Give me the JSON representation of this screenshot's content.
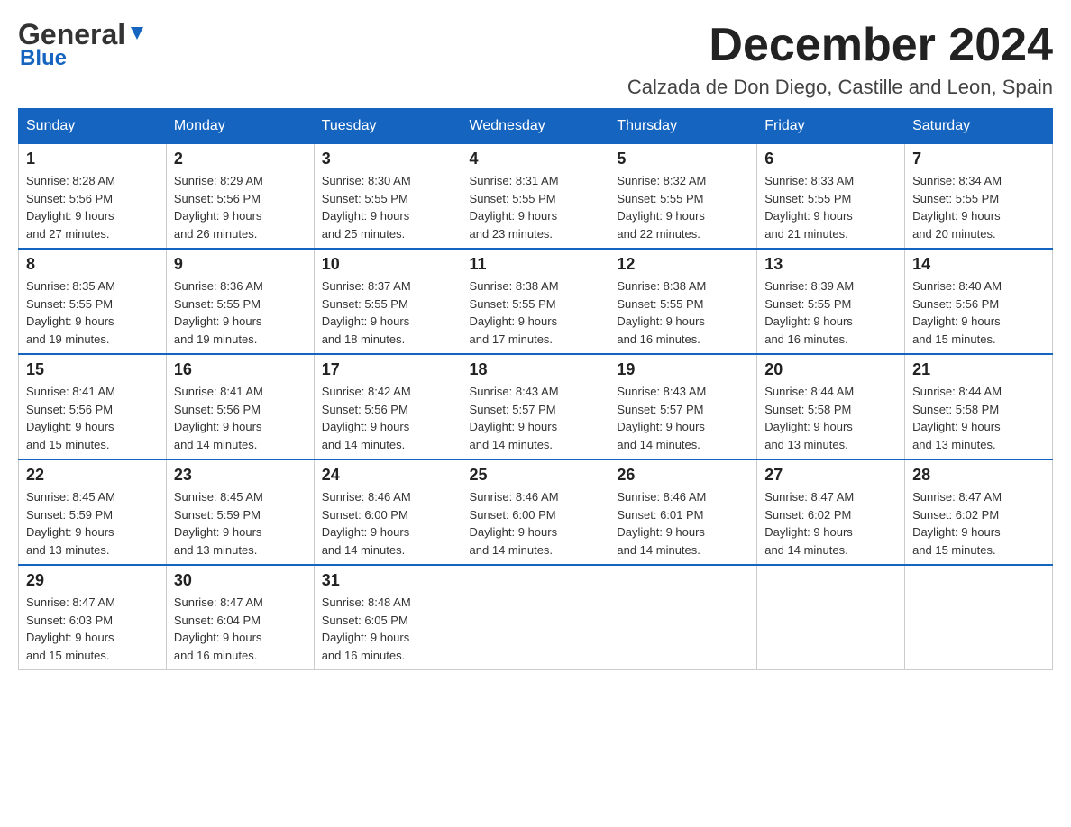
{
  "logo": {
    "line1": "General",
    "triangle": "▶",
    "line2": "Blue"
  },
  "title": {
    "month": "December 2024",
    "location": "Calzada de Don Diego, Castille and Leon, Spain"
  },
  "weekdays": [
    "Sunday",
    "Monday",
    "Tuesday",
    "Wednesday",
    "Thursday",
    "Friday",
    "Saturday"
  ],
  "weeks": [
    [
      {
        "day": "1",
        "sunrise": "8:28 AM",
        "sunset": "5:56 PM",
        "daylight": "9 hours and 27 minutes."
      },
      {
        "day": "2",
        "sunrise": "8:29 AM",
        "sunset": "5:56 PM",
        "daylight": "9 hours and 26 minutes."
      },
      {
        "day": "3",
        "sunrise": "8:30 AM",
        "sunset": "5:55 PM",
        "daylight": "9 hours and 25 minutes."
      },
      {
        "day": "4",
        "sunrise": "8:31 AM",
        "sunset": "5:55 PM",
        "daylight": "9 hours and 23 minutes."
      },
      {
        "day": "5",
        "sunrise": "8:32 AM",
        "sunset": "5:55 PM",
        "daylight": "9 hours and 22 minutes."
      },
      {
        "day": "6",
        "sunrise": "8:33 AM",
        "sunset": "5:55 PM",
        "daylight": "9 hours and 21 minutes."
      },
      {
        "day": "7",
        "sunrise": "8:34 AM",
        "sunset": "5:55 PM",
        "daylight": "9 hours and 20 minutes."
      }
    ],
    [
      {
        "day": "8",
        "sunrise": "8:35 AM",
        "sunset": "5:55 PM",
        "daylight": "9 hours and 19 minutes."
      },
      {
        "day": "9",
        "sunrise": "8:36 AM",
        "sunset": "5:55 PM",
        "daylight": "9 hours and 19 minutes."
      },
      {
        "day": "10",
        "sunrise": "8:37 AM",
        "sunset": "5:55 PM",
        "daylight": "9 hours and 18 minutes."
      },
      {
        "day": "11",
        "sunrise": "8:38 AM",
        "sunset": "5:55 PM",
        "daylight": "9 hours and 17 minutes."
      },
      {
        "day": "12",
        "sunrise": "8:38 AM",
        "sunset": "5:55 PM",
        "daylight": "9 hours and 16 minutes."
      },
      {
        "day": "13",
        "sunrise": "8:39 AM",
        "sunset": "5:55 PM",
        "daylight": "9 hours and 16 minutes."
      },
      {
        "day": "14",
        "sunrise": "8:40 AM",
        "sunset": "5:56 PM",
        "daylight": "9 hours and 15 minutes."
      }
    ],
    [
      {
        "day": "15",
        "sunrise": "8:41 AM",
        "sunset": "5:56 PM",
        "daylight": "9 hours and 15 minutes."
      },
      {
        "day": "16",
        "sunrise": "8:41 AM",
        "sunset": "5:56 PM",
        "daylight": "9 hours and 14 minutes."
      },
      {
        "day": "17",
        "sunrise": "8:42 AM",
        "sunset": "5:56 PM",
        "daylight": "9 hours and 14 minutes."
      },
      {
        "day": "18",
        "sunrise": "8:43 AM",
        "sunset": "5:57 PM",
        "daylight": "9 hours and 14 minutes."
      },
      {
        "day": "19",
        "sunrise": "8:43 AM",
        "sunset": "5:57 PM",
        "daylight": "9 hours and 14 minutes."
      },
      {
        "day": "20",
        "sunrise": "8:44 AM",
        "sunset": "5:58 PM",
        "daylight": "9 hours and 13 minutes."
      },
      {
        "day": "21",
        "sunrise": "8:44 AM",
        "sunset": "5:58 PM",
        "daylight": "9 hours and 13 minutes."
      }
    ],
    [
      {
        "day": "22",
        "sunrise": "8:45 AM",
        "sunset": "5:59 PM",
        "daylight": "9 hours and 13 minutes."
      },
      {
        "day": "23",
        "sunrise": "8:45 AM",
        "sunset": "5:59 PM",
        "daylight": "9 hours and 13 minutes."
      },
      {
        "day": "24",
        "sunrise": "8:46 AM",
        "sunset": "6:00 PM",
        "daylight": "9 hours and 14 minutes."
      },
      {
        "day": "25",
        "sunrise": "8:46 AM",
        "sunset": "6:00 PM",
        "daylight": "9 hours and 14 minutes."
      },
      {
        "day": "26",
        "sunrise": "8:46 AM",
        "sunset": "6:01 PM",
        "daylight": "9 hours and 14 minutes."
      },
      {
        "day": "27",
        "sunrise": "8:47 AM",
        "sunset": "6:02 PM",
        "daylight": "9 hours and 14 minutes."
      },
      {
        "day": "28",
        "sunrise": "8:47 AM",
        "sunset": "6:02 PM",
        "daylight": "9 hours and 15 minutes."
      }
    ],
    [
      {
        "day": "29",
        "sunrise": "8:47 AM",
        "sunset": "6:03 PM",
        "daylight": "9 hours and 15 minutes."
      },
      {
        "day": "30",
        "sunrise": "8:47 AM",
        "sunset": "6:04 PM",
        "daylight": "9 hours and 16 minutes."
      },
      {
        "day": "31",
        "sunrise": "8:48 AM",
        "sunset": "6:05 PM",
        "daylight": "9 hours and 16 minutes."
      },
      null,
      null,
      null,
      null
    ]
  ],
  "labels": {
    "sunrise": "Sunrise:",
    "sunset": "Sunset:",
    "daylight": "Daylight:"
  }
}
